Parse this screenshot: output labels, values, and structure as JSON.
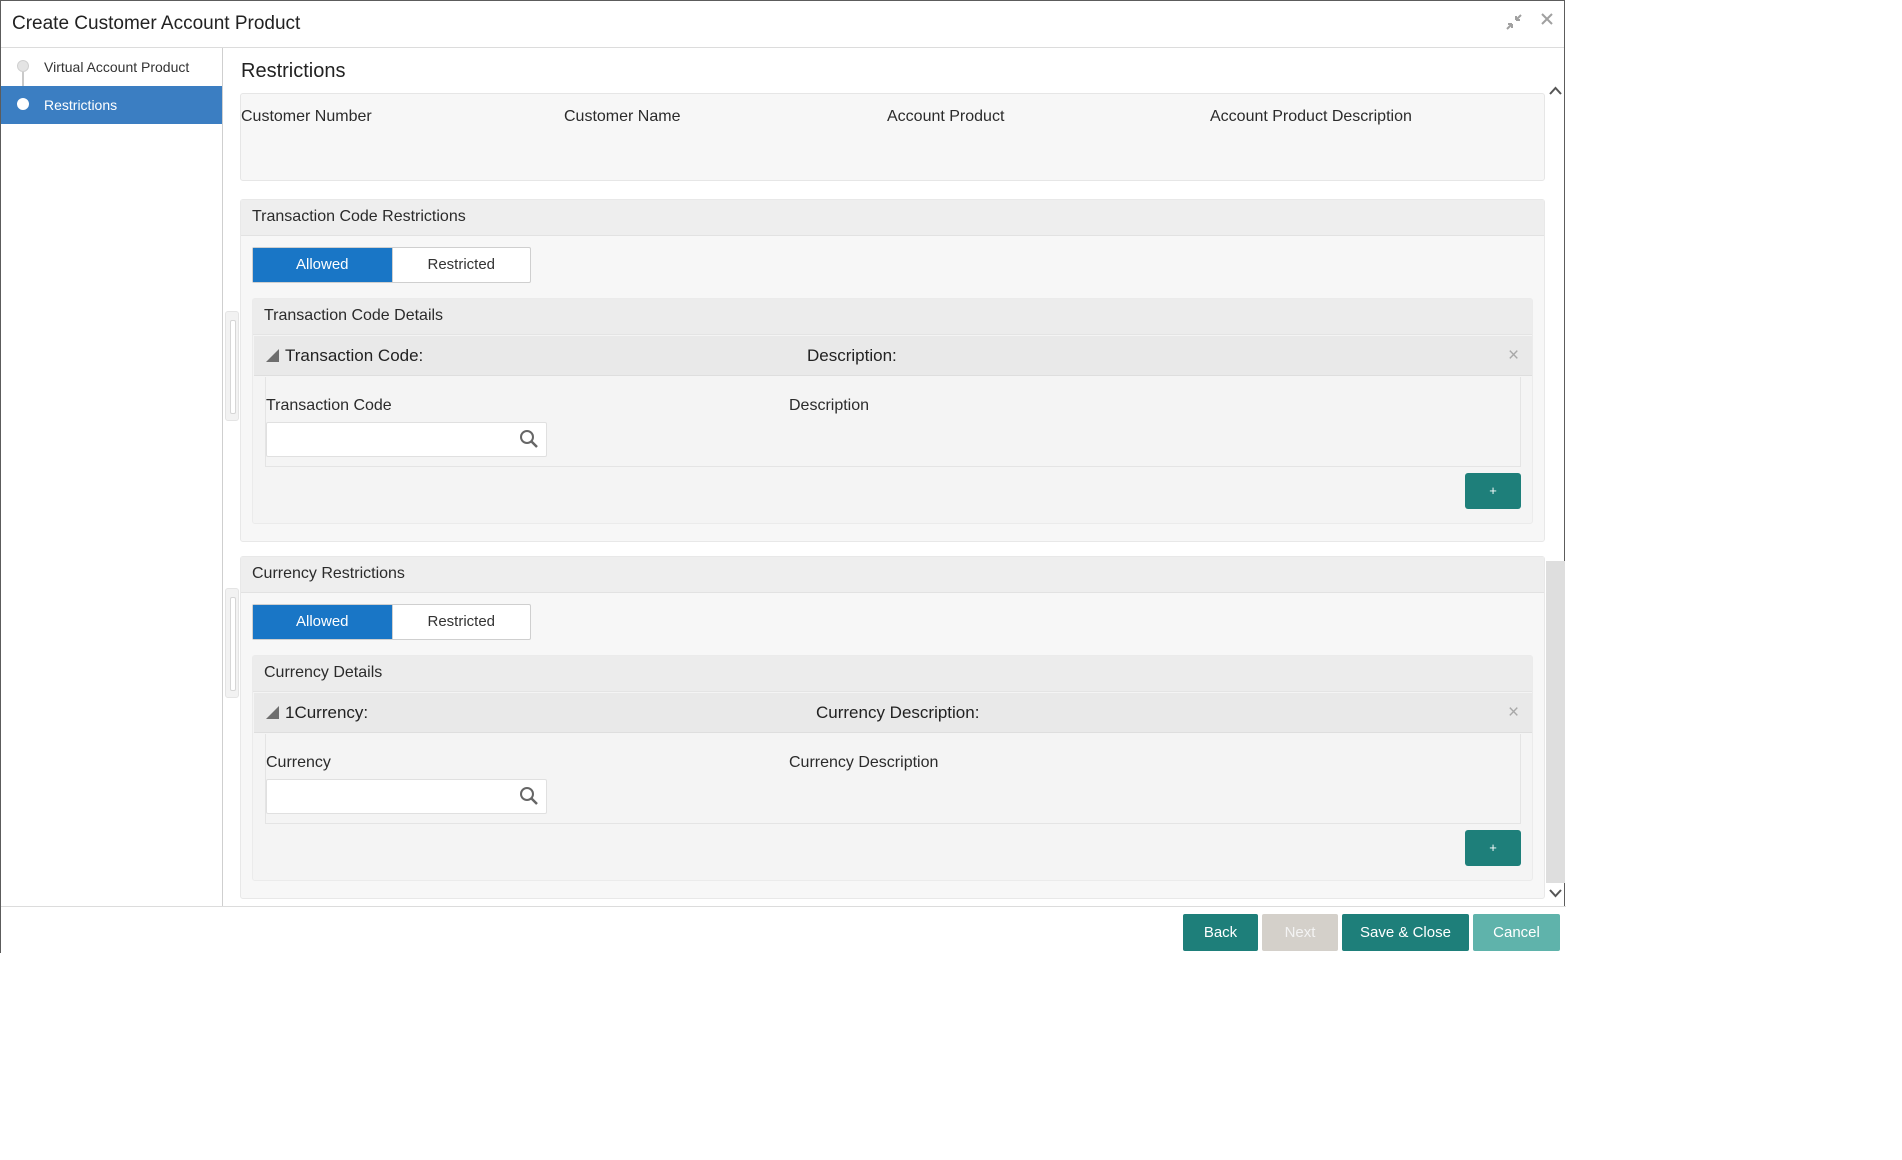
{
  "window": {
    "title": "Create Customer Account Product",
    "minimize_icon": "minimize-icon",
    "close_icon": "close-icon"
  },
  "sidebar": {
    "items": [
      {
        "label": "Virtual Account Product",
        "active": false
      },
      {
        "label": "Restrictions",
        "active": true
      }
    ]
  },
  "main": {
    "title": "Restrictions",
    "info": {
      "customer_number": "Customer Number",
      "customer_name": "Customer Name",
      "account_product": "Account Product",
      "account_product_description": "Account Product Description"
    }
  },
  "transaction_code_restrictions": {
    "title": "Transaction Code Restrictions",
    "toggle": {
      "allowed": "Allowed",
      "restricted": "Restricted",
      "selected": "Allowed"
    },
    "details": {
      "title": "Transaction Code Details",
      "row_key": "Transaction Code:",
      "row_desc": "Description:",
      "field_label": "Transaction Code",
      "field_value": "",
      "desc_label": "Description",
      "add_label": "+"
    }
  },
  "currency_restrictions": {
    "title": "Currency Restrictions",
    "toggle": {
      "allowed": "Allowed",
      "restricted": "Restricted",
      "selected": "Allowed"
    },
    "details": {
      "title": "Currency Details",
      "row_key": "1Currency:",
      "row_desc": "Currency Description:",
      "field_label": "Currency",
      "field_value": "",
      "desc_label": "Currency Description",
      "add_label": "+"
    }
  },
  "footer": {
    "back": "Back",
    "next": "Next",
    "save_close": "Save & Close",
    "cancel": "Cancel"
  },
  "colors": {
    "accent_blue": "#1976c6",
    "sidebar_active": "#3b7ec2",
    "teal": "#1e7f7a",
    "teal_light": "#5fb3ab",
    "disabled": "#d4d0ca"
  }
}
